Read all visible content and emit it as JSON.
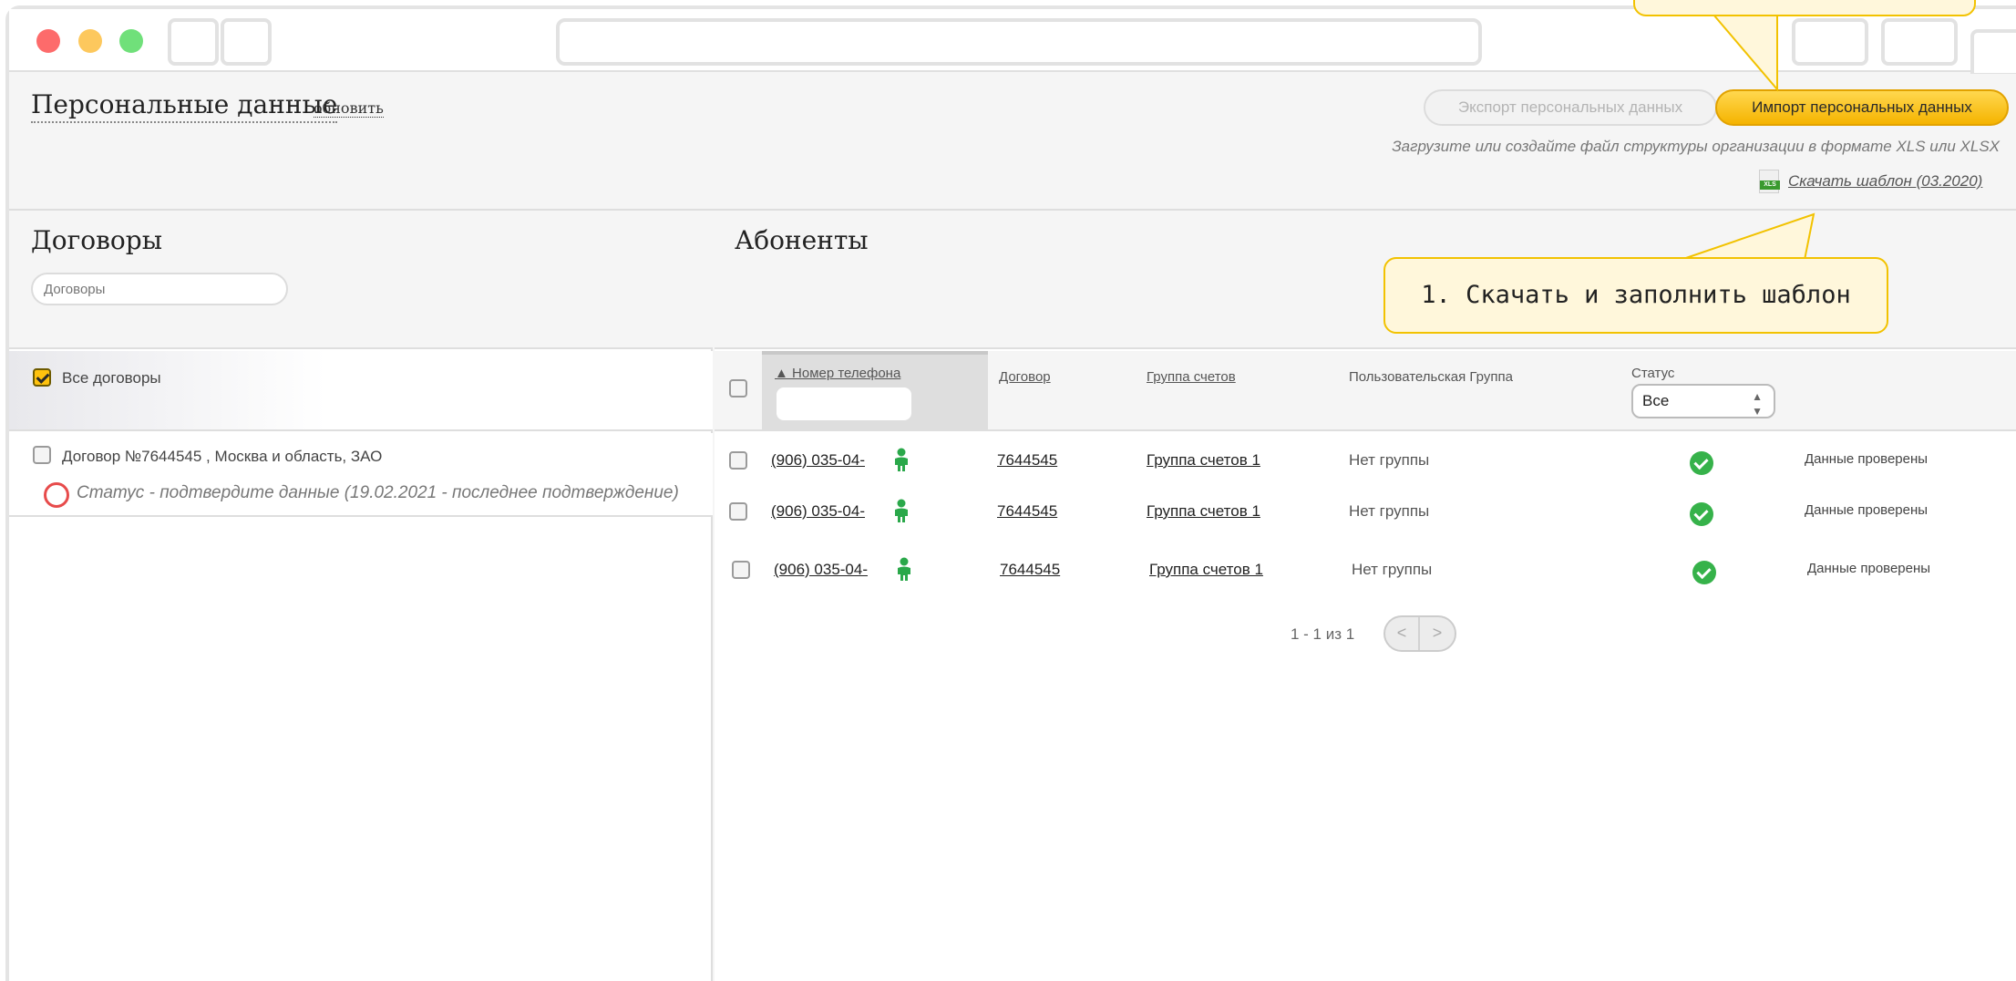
{
  "header": {
    "title": "Персональные данные",
    "refresh": "обновить",
    "export_label": "Экспорт персональных данных",
    "import_label": "Импорт персональных данных",
    "upload_hint": "Загрузите или создайте файл структуры организации в формате XLS или XLSX",
    "xls_badge": "XLS",
    "download_template": "Скачать шаблон (03.2020)"
  },
  "contracts": {
    "title": "Договоры",
    "search_placeholder": "Договоры",
    "all_label": "Все договоры",
    "item_name": "Договор №7644545       , Москва и область, ЗАО",
    "item_status": "Статус - подтвердите данные (19.02.2021 - последнее подтверждение)"
  },
  "subscribers": {
    "title": "Абоненты",
    "columns": {
      "phone": "▲ Номер телефона",
      "contract": "Договор",
      "group": "Группа счетов",
      "user_group": "Пользовательская Группа",
      "status": "Статус"
    },
    "status_filter": "Все",
    "rows": [
      {
        "phone": "(906) 035-04-",
        "contract": "7644545",
        "group": "Группа счетов 1",
        "user_group": "Нет группы",
        "verified": "Данные проверены"
      },
      {
        "phone": "(906) 035-04-",
        "contract": "7644545",
        "group": "Группа счетов 1",
        "user_group": "Нет группы",
        "verified": "Данные проверены"
      },
      {
        "phone": "(906) 035-04-",
        "contract": "7644545",
        "group": "Группа счетов 1",
        "user_group": "Нет группы",
        "verified": "Данные проверены"
      }
    ],
    "pager": {
      "text": "1 - 1 из 1",
      "prev": "<",
      "next": ">"
    }
  },
  "callouts": {
    "download": "1. Скачать и заполнить шаблон"
  },
  "colors": {
    "accent": "#ffc20e",
    "ok": "#36b24a",
    "alert": "#e74b4b"
  }
}
